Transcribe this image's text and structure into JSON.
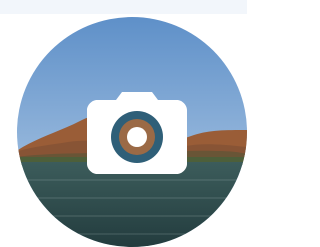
{
  "avatar": {
    "image_label": "landscape-photo",
    "overlay_icon": "camera-icon",
    "tooltip": ""
  },
  "colors": {
    "page_background": "#ffffff",
    "top_strip": "#f2f6fb",
    "sky_top": "#5d8fc8",
    "sky_bottom": "#b9d0e8",
    "hills": "#9a5d37",
    "water_top": "#3c5c5b",
    "water_bottom": "#233c3e",
    "icon_fill": "#ffffff"
  }
}
